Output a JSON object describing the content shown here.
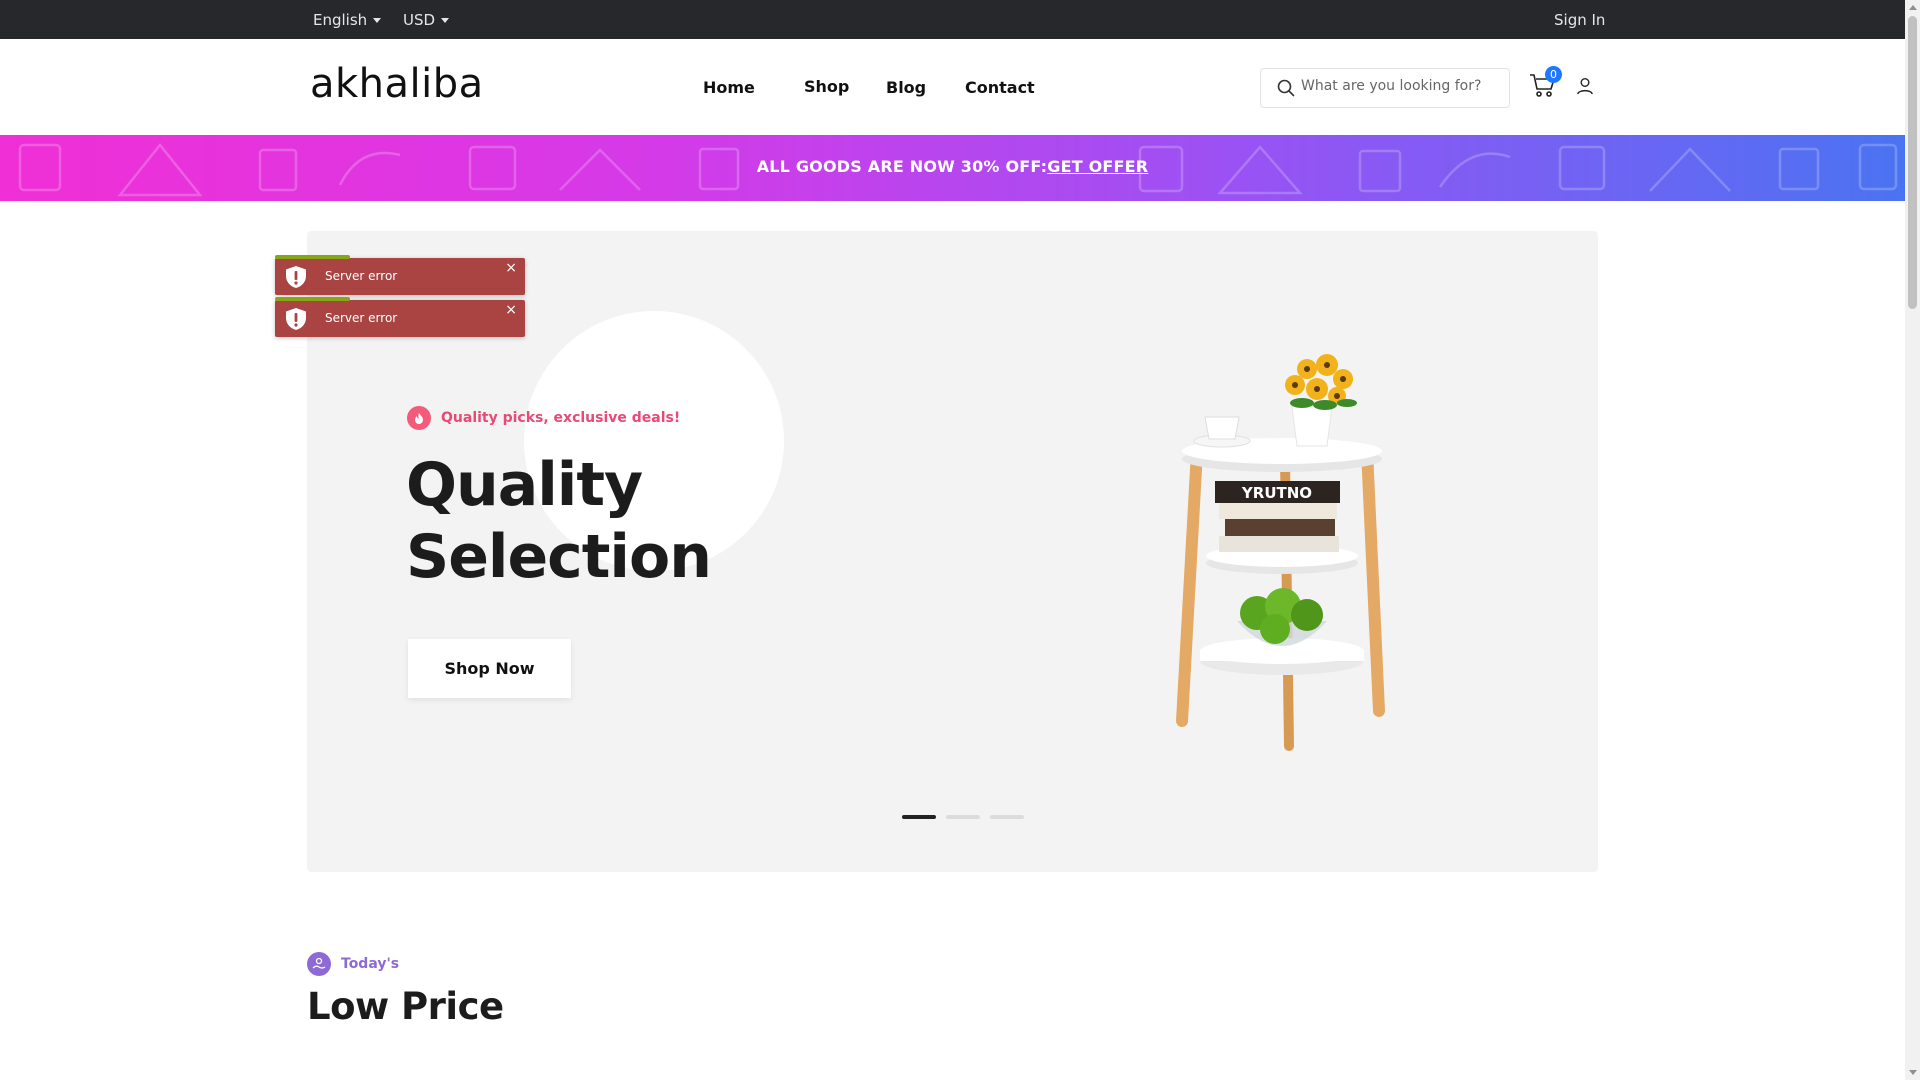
{
  "topbar": {
    "language": "English",
    "currency": "USD",
    "sign_in": "Sign In"
  },
  "header": {
    "logo": "akhaliba",
    "nav": [
      "Home",
      "Shop",
      "Blog",
      "Contact"
    ],
    "search_placeholder": "What are you looking for?",
    "cart_count": "0"
  },
  "promo": {
    "text": "ALL GOODS ARE NOW 30% OFF:",
    "link": "GET OFFER"
  },
  "toasts": [
    {
      "message": "Server error",
      "close": "×"
    },
    {
      "message": "Server error",
      "close": "×"
    }
  ],
  "hero": {
    "tagline": "Quality picks, exclusive deals!",
    "title": "Quality Selection",
    "button": "Shop Now",
    "slides_total": 3,
    "active_slide": 1
  },
  "section": {
    "eyebrow": "Today's",
    "title": "Low Price"
  },
  "colors": {
    "topbar": "#26282b",
    "accent_pink": "#e84a76",
    "accent_purple": "#8e6ad6",
    "toast": "#a94442",
    "badge": "#1f78ff"
  }
}
